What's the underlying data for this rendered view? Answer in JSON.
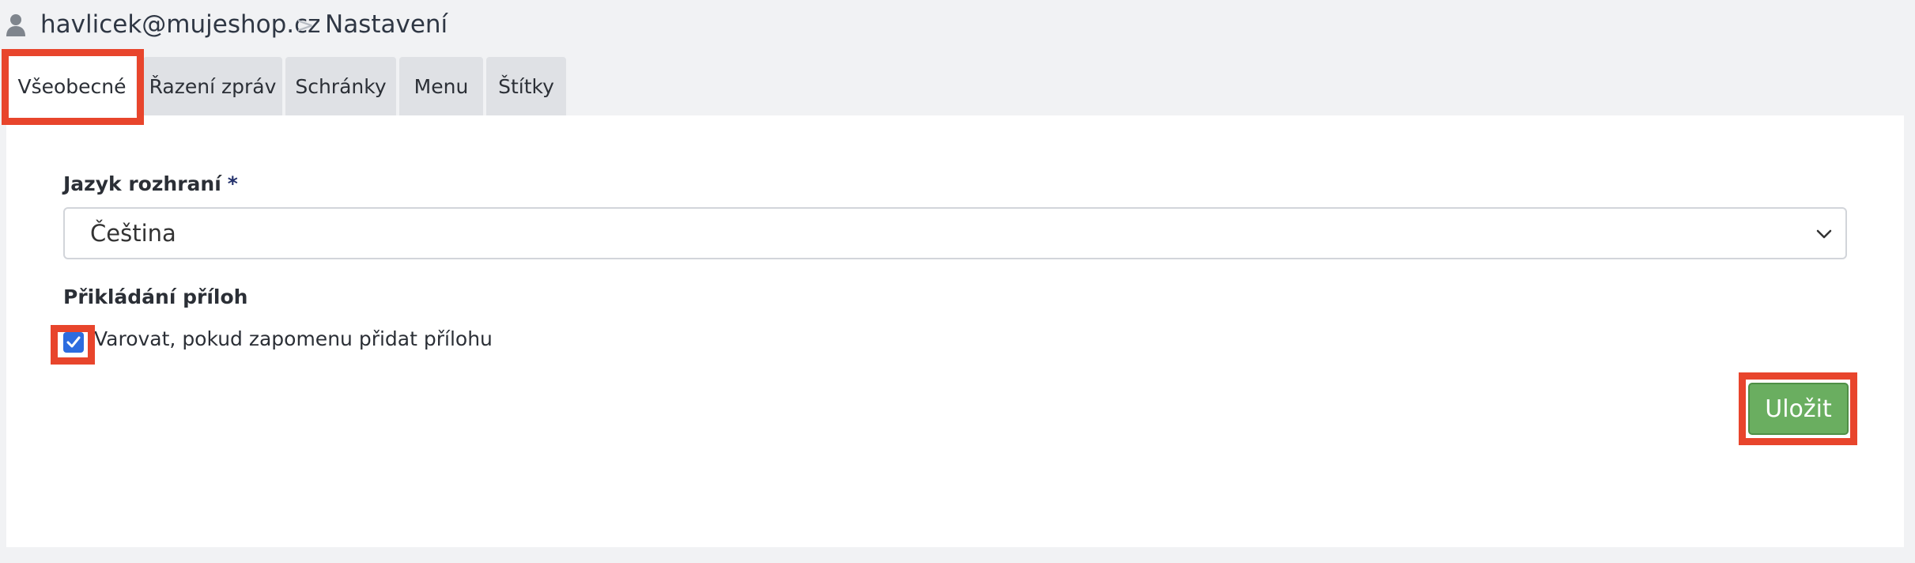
{
  "breadcrumb": {
    "user_email": "havlicek@mujeshop.cz",
    "separator": ">",
    "current_page": "Nastavení"
  },
  "tabs": [
    {
      "label": "Všeobecné",
      "active": true
    },
    {
      "label": "Řazení zpráv",
      "active": false
    },
    {
      "label": "Schránky",
      "active": false
    },
    {
      "label": "Menu",
      "active": false
    },
    {
      "label": "Štítky",
      "active": false
    }
  ],
  "form": {
    "language": {
      "label": "Jazyk rozhraní",
      "required_mark": "*",
      "selected_value": "Čeština"
    },
    "attachments": {
      "section_label": "Přikládání příloh",
      "warn_checkbox_label": "Varovat, pokud zapomenu přidat přílohu",
      "warn_checked": true
    },
    "save_label": "Uložit"
  },
  "colors": {
    "highlight": "#e8452c",
    "save_button": "#6aae60",
    "checkbox": "#2d6cdf"
  }
}
